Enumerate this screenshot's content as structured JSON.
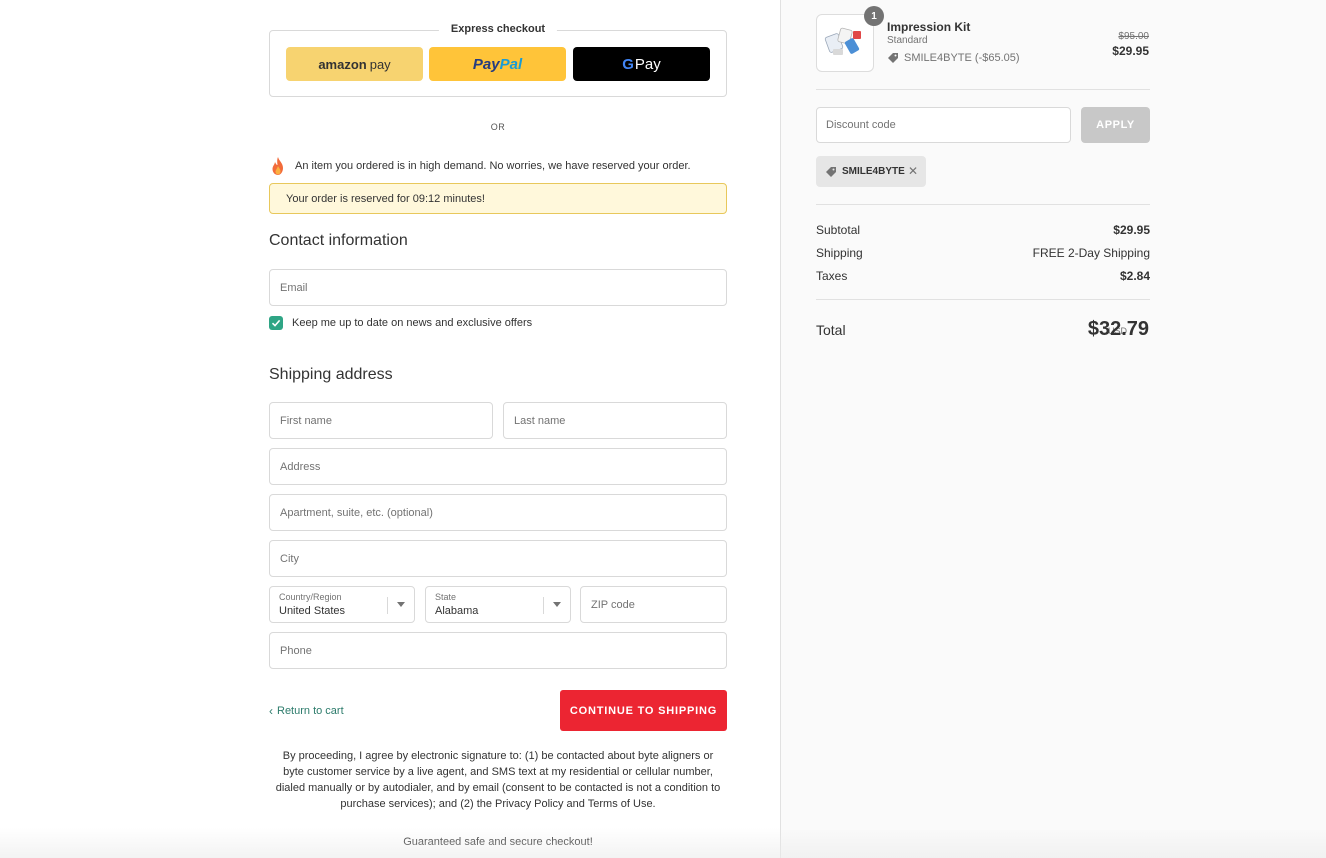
{
  "express": {
    "title": "Express checkout",
    "amazon_word": "amazon",
    "amazon_pay": "pay",
    "paypal_a": "Pay",
    "paypal_b": "Pal",
    "gpay_g": "G",
    "gpay_label": "Pay"
  },
  "or_label": "OR",
  "demand": {
    "message": "An item you ordered is in high demand. No worries, we have reserved your order."
  },
  "reservation": {
    "message": "Your order is reserved for 09:12 minutes!"
  },
  "contact": {
    "heading": "Contact information",
    "email_placeholder": "Email",
    "newsletter_label": "Keep me up to date on news and exclusive offers",
    "newsletter_checked": true
  },
  "shipping": {
    "heading": "Shipping address",
    "first_name_placeholder": "First name",
    "last_name_placeholder": "Last name",
    "address_placeholder": "Address",
    "apartment_placeholder": "Apartment, suite, etc. (optional)",
    "city_placeholder": "City",
    "country_label": "Country/Region",
    "country_value": "United States",
    "state_label": "State",
    "state_value": "Alabama",
    "zip_placeholder": "ZIP code",
    "phone_placeholder": "Phone"
  },
  "actions": {
    "return_label": "Return to cart",
    "continue_label": "CONTINUE TO SHIPPING"
  },
  "legal": "By proceeding, I agree by electronic signature to: (1) be contacted about byte aligners or byte customer service by a live agent, and SMS text at my residential or cellular number, dialed manually or by autodialer, and by email (consent to be contacted is not a condition to purchase services); and (2) the Privacy Policy and Terms of Use.",
  "secure_label": "Guaranteed safe and secure checkout!",
  "summary": {
    "product": {
      "quantity": "1",
      "name": "Impression Kit",
      "variant": "Standard",
      "discount": "SMILE4BYTE (-$65.05)",
      "old_price": "$95.00",
      "price": "$29.95"
    },
    "discount_placeholder": "Discount code",
    "apply_label": "APPLY",
    "applied_code": "SMILE4BYTE",
    "subtotal_label": "Subtotal",
    "subtotal_value": "$29.95",
    "shipping_label": "Shipping",
    "shipping_value": "FREE 2-Day Shipping",
    "taxes_label": "Taxes",
    "taxes_value": "$2.84",
    "total_label": "Total",
    "total_currency": "USD",
    "total_value": "$32.79"
  },
  "colors": {
    "accent_red": "#ec2532",
    "link_green": "#2c7b6b",
    "checkbox_green": "#2fa585",
    "reserve_bg": "#fff8db",
    "reserve_border": "#e8c85b"
  }
}
